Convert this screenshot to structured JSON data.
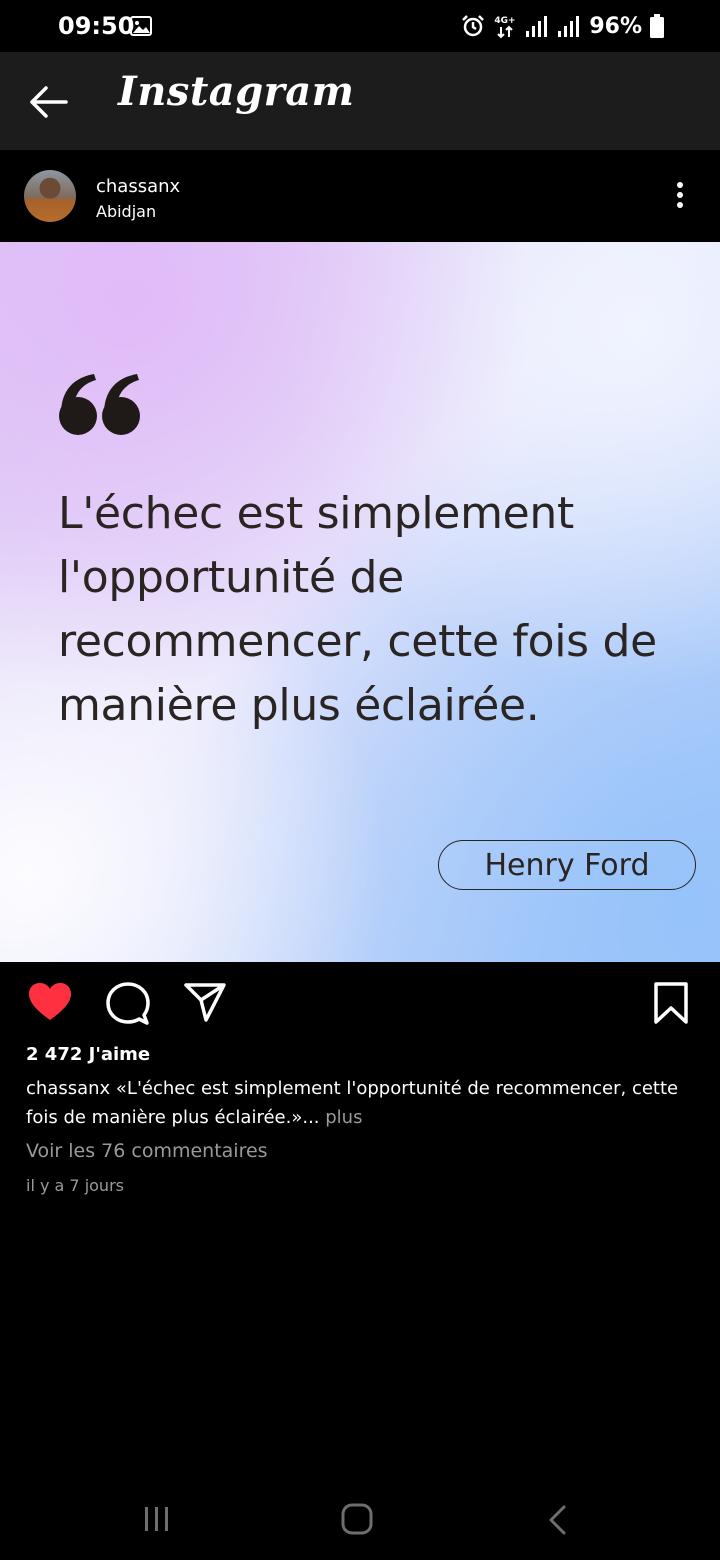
{
  "status_bar": {
    "time": "09:50",
    "network": "4G+",
    "battery": "96%"
  },
  "app_bar": {
    "title": "Instagram"
  },
  "post": {
    "username": "chassanx",
    "location": "Abidjan",
    "image": {
      "quote": "L'échec est simplement l'opportunité de recommencer, cette fois de manière plus éclairée.",
      "author": "Henry Ford"
    },
    "likes": "2 472 J'aime",
    "caption_username": "chassanx",
    "caption_text": "«L'échec est simplement l'opportunité de recommencer, cette fois de manière plus éclairée.»...",
    "caption_more": "plus",
    "view_comments": "Voir les 76 commentaires",
    "timestamp": "il y a 7 jours"
  },
  "colors": {
    "like_active": "#ff3040",
    "secondary_text": "#9a9a9a",
    "app_bar_bg": "#1c1c1c"
  },
  "icons": {
    "back": "arrow-left-icon",
    "more": "more-vertical-icon",
    "like": "heart-filled-icon",
    "comment": "comment-bubble-icon",
    "share": "paper-plane-icon",
    "save": "bookmark-icon",
    "quote": "quote-mark-icon"
  }
}
